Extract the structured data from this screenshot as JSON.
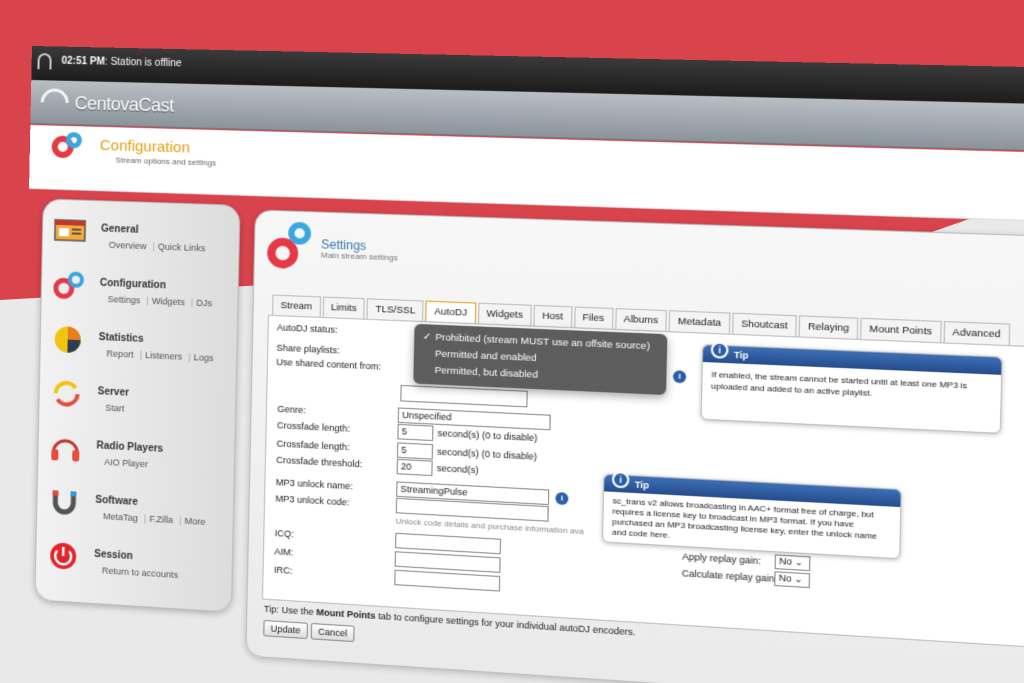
{
  "topbar": {
    "time": "02:51 PM",
    "status": ": Station is offline"
  },
  "brand": "CentovaCast",
  "header": {
    "title": "Configuration",
    "subtitle": "Stream options and settings"
  },
  "sidebar": [
    {
      "title": "General",
      "links": [
        "Overview",
        "Quick Links"
      ],
      "icon": "window-icon"
    },
    {
      "title": "Configuration",
      "links": [
        "Settings",
        "Widgets",
        "DJs"
      ],
      "icon": "gears-icon"
    },
    {
      "title": "Statistics",
      "links": [
        "Report",
        "Listeners",
        "Logs"
      ],
      "icon": "pie-chart-icon"
    },
    {
      "title": "Server",
      "links": [
        "Start"
      ],
      "icon": "refresh-icon"
    },
    {
      "title": "Radio Players",
      "links": [
        "AIO Player"
      ],
      "icon": "headphones-icon"
    },
    {
      "title": "Software",
      "links": [
        "MetaTag",
        "F.Zilla",
        "More"
      ],
      "icon": "magnet-icon"
    },
    {
      "title": "Session",
      "links": [
        "Return to accounts"
      ],
      "icon": "power-icon"
    }
  ],
  "panel": {
    "title": "Settings",
    "subtitle": "Main stream settings"
  },
  "tabs": [
    "Stream",
    "Limits",
    "TLS/SSL",
    "AutoDJ",
    "Widgets",
    "Host",
    "Files",
    "Albums",
    "Metadata",
    "Shoutcast",
    "Relaying",
    "Mount Points",
    "Advanced"
  ],
  "active_tab": "AutoDJ",
  "form": {
    "autodj_status_label": "AutoDJ status:",
    "share_playlists_label": "Share playlists:",
    "shared_content_label": "Use shared content from:",
    "genre_label": "Genre:",
    "genre_value": "Unspecified",
    "crossfade1_label": "Crossfade length:",
    "crossfade1_value": "5",
    "crossfade1_unit": "second(s) (0 to disable)",
    "crossfade2_label": "Crossfade length:",
    "crossfade2_value": "5",
    "crossfade2_unit": "second(s) (0 to disable)",
    "threshold_label": "Crossfade threshold:",
    "threshold_value": "20",
    "threshold_unit": "second(s)",
    "unlock_name_label": "MP3 unlock name:",
    "unlock_name_value": "StreamingPulse",
    "unlock_code_label": "MP3 unlock code:",
    "unlock_note": "Unlock code details and purchase information ava",
    "icq_label": "ICQ:",
    "aim_label": "AIM:",
    "irc_label": "IRC:",
    "apply_gain_label": "Apply replay gain:",
    "apply_gain_value": "No",
    "calc_gain_label": "Calculate replay gain:",
    "calc_gain_value": "No"
  },
  "dropdown": {
    "check": "✓",
    "options": [
      "Prohibited (stream MUST use an offsite source)",
      "Permitted and enabled",
      "Permitted, but disabled"
    ],
    "selected": 0
  },
  "tip1": {
    "title": "Tip",
    "body": "If enabled, the stream cannot be started until at least one MP3 is uploaded and added to an active playlist."
  },
  "tip2": {
    "title": "Tip",
    "body": "sc_trans v2 allows broadcasting in AAC+ format free of charge, but requires a license key to broadcast in MP3 format. If you have purchased an MP3 broadcasting license key, enter the unlock name and code here."
  },
  "bottom_tip": {
    "prefix": "Tip: Use the ",
    "bold": "Mount Points",
    "suffix": " tab to configure settings for your individual autoDJ encoders."
  },
  "buttons": {
    "update": "Update",
    "cancel": "Cancel"
  },
  "colors": {
    "background_red": "#d9434c",
    "accent_orange": "#e8a013",
    "tip_blue": "#2b5da8"
  }
}
